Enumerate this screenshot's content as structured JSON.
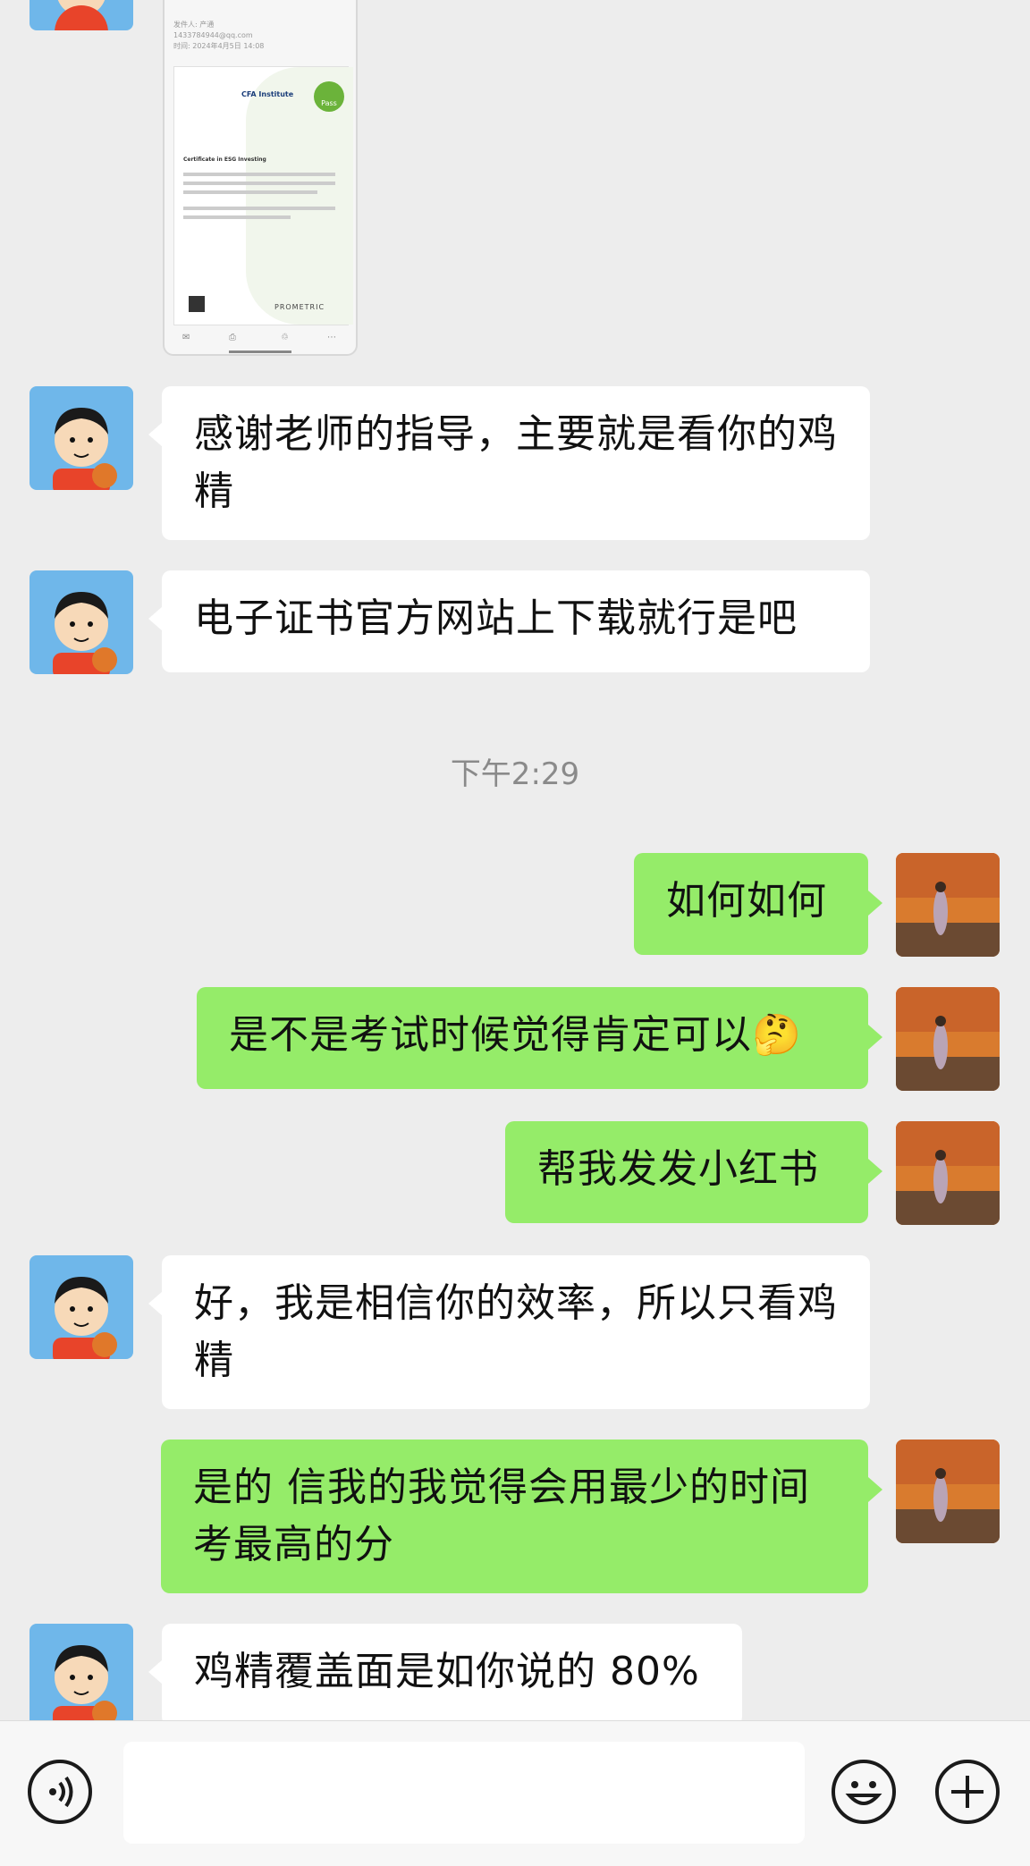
{
  "colors": {
    "background": "#ededed",
    "incoming_bubble": "#ffffff",
    "outgoing_bubble": "#95ec69",
    "timestamp_text": "#8a8a8a"
  },
  "image_preview": {
    "sender_line": "发件人: 产通",
    "recipient_line": "1433784944@qq.com",
    "date_line": "时间: 2024年4月5日 14:08",
    "logo_text": "CFA Institute",
    "badge_text": "Pass",
    "cert_title": "Certificate in ESG Investing",
    "brand": "PROMETRIC"
  },
  "messages": [
    {
      "direction": "in",
      "text": "感谢老师的指导，主要就是看你的鸡精"
    },
    {
      "direction": "in",
      "text": "电子证书官方网站上下载就行是吧"
    },
    {
      "direction": "out",
      "text": "如何如何"
    },
    {
      "direction": "out",
      "text": "是不是考试时候觉得肯定可以🤔"
    },
    {
      "direction": "out",
      "text": "帮我发发小红书"
    },
    {
      "direction": "in",
      "text": "好，我是相信你的效率，所以只看鸡精"
    },
    {
      "direction": "out",
      "text": "是的 信我的我觉得会用最少的时间考最高的分"
    },
    {
      "direction": "in",
      "text": "鸡精覆盖面是如你说的 80%"
    }
  ],
  "timestamp": "下午2:29",
  "input_bar": {
    "voice_icon": "voice-icon",
    "emoji_icon": "emoji-icon",
    "plus_icon": "plus-icon"
  }
}
